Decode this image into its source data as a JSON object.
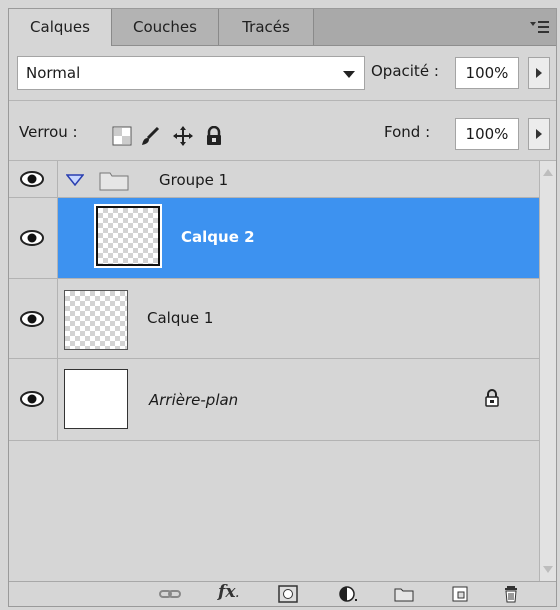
{
  "tabs": [
    {
      "label": "Calques",
      "active": true
    },
    {
      "label": "Couches",
      "active": false
    },
    {
      "label": "Tracés",
      "active": false
    }
  ],
  "blend_mode": "Normal",
  "opacity": {
    "label": "Opacité :",
    "value": "100%"
  },
  "lock": {
    "label": "Verrou :"
  },
  "fill": {
    "label": "Fond :",
    "value": "100%"
  },
  "layers": [
    {
      "name": "Groupe 1",
      "type": "group",
      "expanded": true
    },
    {
      "name": "Calque 2",
      "type": "layer",
      "selected": true
    },
    {
      "name": "Calque 1",
      "type": "layer"
    },
    {
      "name": "Arrière-plan",
      "type": "background",
      "locked": true
    }
  ],
  "colors": {
    "selection": "#3d92f0",
    "panel": "#d6d6d6"
  },
  "toolbar_icons": [
    "link-layers-icon",
    "fx-icon",
    "add-mask-icon",
    "adjustment-layer-icon",
    "new-group-icon",
    "new-layer-icon",
    "delete-layer-icon"
  ]
}
